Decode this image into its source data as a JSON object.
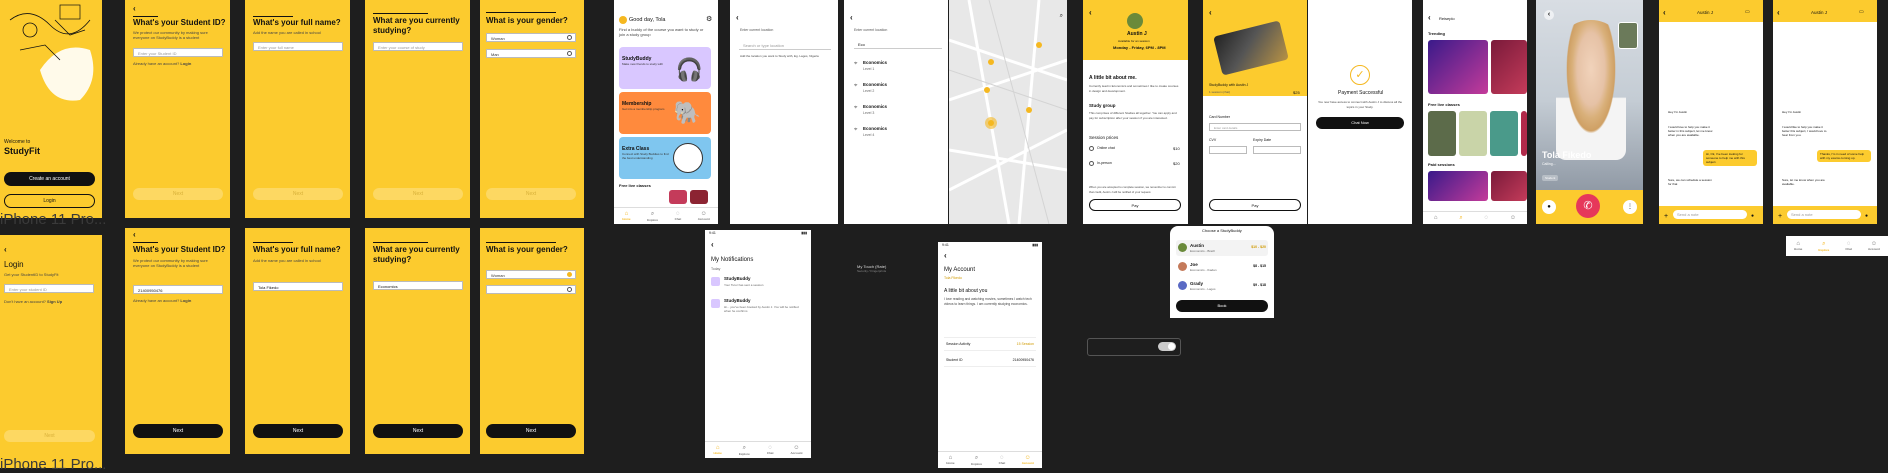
{
  "common": {
    "frame_label": "iPhone 11 Pro...",
    "next": "Next",
    "time": "9:41"
  },
  "welcome": {
    "title": "Welcome to",
    "brand": "StudyFit",
    "create": "Create an account",
    "login": "Login"
  },
  "login": {
    "title": "Login",
    "sub": "Get your StudentID to StudyFit",
    "placeholder": "Enter your student ID",
    "footer": "Don't have an account?",
    "link": "Sign Up",
    "next": "Next"
  },
  "student_id": {
    "title": "What's your Student ID?",
    "sub": "We protect our community by making sure everyone on StudyBuddy is a student",
    "placeholder": "Enter your Student ID",
    "value": "21400950476",
    "footer": "Already have an account?",
    "link": "Login"
  },
  "full_name": {
    "title": "What's your full name?",
    "sub": "Add the name you are called in school",
    "placeholder": "Enter your full name",
    "value": "Tola Fikedo"
  },
  "studying": {
    "title": "What are you currently studying?",
    "placeholder": "Enter your course of study",
    "value": "Economics"
  },
  "gender": {
    "title": "What is your gender?",
    "options": [
      "Woman",
      "Man"
    ]
  },
  "home": {
    "greeting": "Good day, Tola",
    "sub": "Find a buddy of the course you want to study or join a study group",
    "cards": [
      {
        "title": "StudyBuddy",
        "desc": "Make new friends to study with"
      },
      {
        "title": "Membership",
        "desc": "Get into a membership program"
      },
      {
        "title": "Extra Class",
        "desc": "Connect with Study Buddies to find the best understanding"
      }
    ],
    "free_label": "Free live classes",
    "nav": [
      "Home",
      "Explore",
      "Chat",
      "Account"
    ]
  },
  "search1": {
    "placeholder": "Enter current location",
    "field": "Search or type location",
    "hint": "Add the location you want to Study with, Eg. Lagos, Nigeria"
  },
  "search2": {
    "placeholder": "Enter current location",
    "query": "Eco",
    "results": [
      {
        "t": "Economics",
        "s": "Level 1"
      },
      {
        "t": "Economics",
        "s": "Level 2"
      },
      {
        "t": "Economics",
        "s": "Level 3"
      },
      {
        "t": "Economics",
        "s": "Level 4"
      }
    ]
  },
  "profile": {
    "name": "Austin J",
    "sub": "Available for an session",
    "avail": "Monday - Friday, 6PM - 8PM",
    "about_title": "A little bit about me.",
    "about": "Currently lead in Economics and sometimes I like to create courses in design and development.",
    "group_title": "Study group",
    "group_text": "This comprises of different Studies all together. You can apply and pay for subscription after your session if you are interested.",
    "session_title": "Session prices",
    "sessions": [
      {
        "t": "Online chat",
        "p": "$10"
      },
      {
        "t": "In-person",
        "p": "$20"
      }
    ],
    "note": "When you are accepted to complete session, we remember to commit that credit, Austin J will be notified of your request.",
    "pay": "Pay"
  },
  "payment": {
    "card_label": "StudyBuddy with Austin J",
    "amount": "$25",
    "total": "1 session (chat)",
    "card_number": "Card Number",
    "card_placeholder": "Enter card details",
    "cvv": "CVV",
    "expiry": "Expiry Date",
    "pay": "Pay"
  },
  "success": {
    "title": "Payment Successful",
    "sub": "You now have access to connect with Austin J to discuss all the topics in your Study.",
    "btn": "Chat Now"
  },
  "explore": {
    "query": "Reiseplo",
    "trending": "Trending",
    "free": "Free live classes",
    "paid": "Paid sessions"
  },
  "call": {
    "name": "Tola Fikedo",
    "status": "Calling...",
    "tag": "Student"
  },
  "chat1": {
    "title": "Austin J",
    "messages": [
      {
        "side": "in",
        "text": "Hey I'm Austin"
      },
      {
        "side": "in",
        "text": "I would love to help you make it better in this subject, let me know when you are available."
      },
      {
        "side": "out",
        "text": "Hi, Ok, I've been looking for someone to help me with this subject."
      },
      {
        "side": "in",
        "text": "Sure, we can schedule a session for that"
      }
    ],
    "input": "Send a note"
  },
  "chat2": {
    "title": "Austin J",
    "messages": [
      {
        "side": "in",
        "text": "Hey I'm Austin"
      },
      {
        "side": "in",
        "text": "I would like to help you make it better this subject, I would love to hear from you."
      },
      {
        "side": "out",
        "text": "Thanks, I'm in need of some help with my exams coming up."
      },
      {
        "side": "in",
        "text": "Sure, let me know when you are available."
      }
    ],
    "input": "Send a note"
  },
  "notifications": {
    "title": "My Notifications",
    "today": "Today",
    "items": [
      {
        "t": "StudyBuddy",
        "s": "Your Tutor has sent a session"
      },
      {
        "t": "StudyBuddy",
        "s": "Hi... you've been booked by Austin J. You will be notified when he confirms"
      }
    ],
    "nav": [
      "Home",
      "Explore",
      "Chat",
      "Account"
    ]
  },
  "touch_id": {
    "title": "My Touch (Rate)",
    "sub": "Security / Fingerprints"
  },
  "account": {
    "title": "My Account",
    "link": "Tola Fikedo",
    "about_title": "A little bit about you",
    "about": "I love reading and watching movies, sometimes I watch tech videos to learn things. I am currently studying economics.",
    "rows": [
      {
        "t": "Session Activity",
        "v": "15 Session"
      },
      {
        "t": "Student ID",
        "v": "21400950476"
      }
    ],
    "nav": [
      "Home",
      "Explore",
      "Chat",
      "Account"
    ]
  },
  "choose": {
    "title": "Choose a StudyBuddy",
    "items": [
      {
        "t": "Austin",
        "s": "Economics - Brazil",
        "p": "$10 - $20"
      },
      {
        "t": "Joe",
        "s": "Economics - Ibadan",
        "p": "$8 - $15"
      },
      {
        "t": "Grady",
        "s": "Economics - Lagos",
        "p": "$9 - $18"
      }
    ],
    "btn": "Book"
  },
  "mini_nav": [
    "Home",
    "Explore",
    "Chat",
    "Account"
  ],
  "colors": {
    "accent": "#fccb2e",
    "dark": "#111111",
    "bg": "#1e1e1e"
  }
}
